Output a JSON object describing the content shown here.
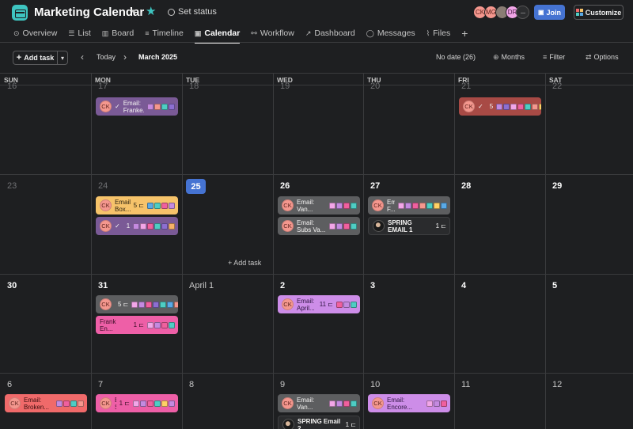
{
  "project": {
    "title": "Marketing Calendar",
    "set_status": "Set status"
  },
  "header": {
    "avatars": [
      "CK",
      "MG",
      "",
      "DR"
    ],
    "more": "···",
    "join_label": "Join",
    "customize_label": "Customize"
  },
  "tabs": [
    {
      "label": "Overview",
      "icon": "overview-icon"
    },
    {
      "label": "List",
      "icon": "list-icon"
    },
    {
      "label": "Board",
      "icon": "board-icon"
    },
    {
      "label": "Timeline",
      "icon": "timeline-icon"
    },
    {
      "label": "Calendar",
      "icon": "calendar-icon",
      "active": true
    },
    {
      "label": "Workflow",
      "icon": "workflow-icon"
    },
    {
      "label": "Dashboard",
      "icon": "dashboard-icon"
    },
    {
      "label": "Messages",
      "icon": "messages-icon"
    },
    {
      "label": "Files",
      "icon": "files-icon"
    }
  ],
  "toolbar": {
    "add_task_label": "Add task",
    "today_label": "Today",
    "month_label": "March 2025",
    "no_date_label": "No date (26)",
    "months_label": "Months",
    "filter_label": "Filter",
    "options_label": "Options"
  },
  "calendar": {
    "weekdays": [
      "SUN",
      "MON",
      "TUE",
      "WED",
      "THU",
      "FRI",
      "SAT"
    ],
    "weeks": [
      [
        "16",
        "17",
        "18",
        "19",
        "20",
        "21",
        "22"
      ],
      [
        "23",
        "24",
        "25",
        "26",
        "27",
        "28",
        "29"
      ],
      [
        "30",
        "31",
        "April 1",
        "2",
        "3",
        "4",
        "5"
      ],
      [
        "6",
        "7",
        "8",
        "9",
        "10",
        "11",
        "12"
      ]
    ],
    "today": "25",
    "cell_add_task": "+ Add task"
  },
  "colors": {
    "today": "#4573d2",
    "join": "#4573d2",
    "app_icon": "#3ec4c0",
    "tag_palette": [
      "#f2a6e8",
      "#c48ae0",
      "#f0609e",
      "#4ecdc4",
      "#f4978e",
      "#ffd166",
      "#5aa9e6",
      "#8d6fd1",
      "#f7b267"
    ]
  },
  "tasks": [
    {
      "id": "t17",
      "week": 0,
      "day": 1,
      "avatar": "CK",
      "check": "✓",
      "name": "Email: Franke...",
      "count": "",
      "color": "#7a5a96",
      "tagcolors": [
        "#c48ae0",
        "#f4978e",
        "#4ecdc4",
        "#8d6fd1"
      ]
    },
    {
      "id": "t21",
      "week": 0,
      "day": 5,
      "avatar": "CK",
      "check": "✓",
      "name": "",
      "count": "5",
      "color": "#a84a45",
      "tagcolors": [
        "#c48ae0",
        "#8d6fd1",
        "#f2a6e8",
        "#f0609e",
        "#4ecdc4",
        "#f4978e",
        "#ffd166"
      ]
    },
    {
      "id": "t24a",
      "week": 1,
      "day": 1,
      "avatar": "CK",
      "check": "",
      "name": "Email: Box...",
      "count": "5 ⊏",
      "color": "#f6c36a",
      "textcolor": "#2b2210",
      "tagcolors": [
        "#5aa9e6",
        "#4ecdc4",
        "#f0609e",
        "#c48ae0"
      ]
    },
    {
      "id": "t24b",
      "week": 1,
      "day": 1,
      "avatar": "CK",
      "check": "✓",
      "name": "",
      "count": "1",
      "color": "#7a5a96",
      "tagcolors": [
        "#c48ae0",
        "#f2a6e8",
        "#f0609e",
        "#4ecdc4",
        "#8d6fd1",
        "#f7b267"
      ]
    },
    {
      "id": "t26a",
      "week": 1,
      "day": 3,
      "avatar": "CK",
      "check": "",
      "name": "Email: Van...",
      "count": "",
      "color": "#5d5e60",
      "tagcolors": [
        "#f2a6e8",
        "#c48ae0",
        "#f0609e",
        "#4ecdc4"
      ]
    },
    {
      "id": "t26b",
      "week": 1,
      "day": 3,
      "avatar": "CK",
      "check": "",
      "name": "Email: Subs Va...",
      "count": "",
      "color": "#5d5e60",
      "tagcolors": [
        "#f2a6e8",
        "#c48ae0",
        "#f0609e",
        "#4ecdc4"
      ]
    },
    {
      "id": "t27a",
      "week": 1,
      "day": 4,
      "avatar": "CK",
      "check": "",
      "name": "Em F...",
      "count": "",
      "color": "#5d5e60",
      "tagcolors": [
        "#f2a6e8",
        "#c48ae0",
        "#f0609e",
        "#f4978e",
        "#4ecdc4",
        "#ffd166",
        "#5aa9e6"
      ]
    },
    {
      "id": "t27b",
      "week": 1,
      "day": 4,
      "avatar": "",
      "photo": true,
      "check": "",
      "name": "SPRING EMAIL 1",
      "count": "1 ⊏",
      "color": "dark",
      "bold": true,
      "tagcolors": []
    },
    {
      "id": "t31a",
      "week": 2,
      "day": 1,
      "avatar": "CK",
      "check": "",
      "name": "",
      "count": "5 ⊏",
      "color": "#5d5e60",
      "tagcolors": [
        "#f2a6e8",
        "#c48ae0",
        "#f0609e",
        "#8d6fd1",
        "#4ecdc4",
        "#5aa9e6",
        "#f4978e"
      ]
    },
    {
      "id": "t31b",
      "week": 2,
      "day": 1,
      "avatar": "",
      "check": "",
      "name": "Frank En...",
      "count": "1 ⊏",
      "color": "#ee5fa7",
      "textcolor": "#3a0d25",
      "tagcolors": [
        "#f2a6e8",
        "#c48ae0",
        "#f0609e",
        "#4ecdc4"
      ]
    },
    {
      "id": "t2a",
      "week": 2,
      "day": 3,
      "avatar": "CK",
      "check": "",
      "name": "Email: April...",
      "count": "11 ⊏",
      "color": "#cd8de8",
      "textcolor": "#2d1440",
      "tagcolors": [
        "#f0609e",
        "#c48ae0",
        "#4ecdc4"
      ]
    },
    {
      "id": "t6a",
      "week": 3,
      "day": 0,
      "avatar": "CK",
      "check": "",
      "name": "Email: Broken...",
      "count": "",
      "color": "#f06a6a",
      "textcolor": "#3a0d0d",
      "tagcolors": [
        "#c48ae0",
        "#f0609e",
        "#4ecdc4",
        "#f4978e"
      ]
    },
    {
      "id": "t7a",
      "week": 3,
      "day": 1,
      "avatar": "CK",
      "check": "",
      "name": "Em S...",
      "count": "1 ⊏",
      "color": "#ee5fa7",
      "textcolor": "#3a0d25",
      "tagcolors": [
        "#f2a6e8",
        "#c48ae0",
        "#f0609e",
        "#4ecdc4",
        "#ffd166",
        "#c48ae0"
      ]
    },
    {
      "id": "t9a",
      "week": 3,
      "day": 3,
      "avatar": "CK",
      "check": "",
      "name": "Email: Van...",
      "count": "",
      "color": "#5d5e60",
      "tagcolors": [
        "#f2a6e8",
        "#c48ae0",
        "#f0609e",
        "#4ecdc4"
      ]
    },
    {
      "id": "t9b",
      "week": 3,
      "day": 3,
      "avatar": "",
      "photo": true,
      "check": "",
      "name": "SPRING Email 2",
      "count": "1 ⊏",
      "color": "dark",
      "bold": true,
      "tagcolors": []
    },
    {
      "id": "t10a",
      "week": 3,
      "day": 4,
      "avatar": "CK",
      "check": "",
      "name": "Email: Encore...",
      "count": "",
      "color": "#cd8de8",
      "textcolor": "#2d1440",
      "tagcolors": [
        "#f2a6e8",
        "#c48ae0",
        "#f0609e"
      ]
    }
  ]
}
